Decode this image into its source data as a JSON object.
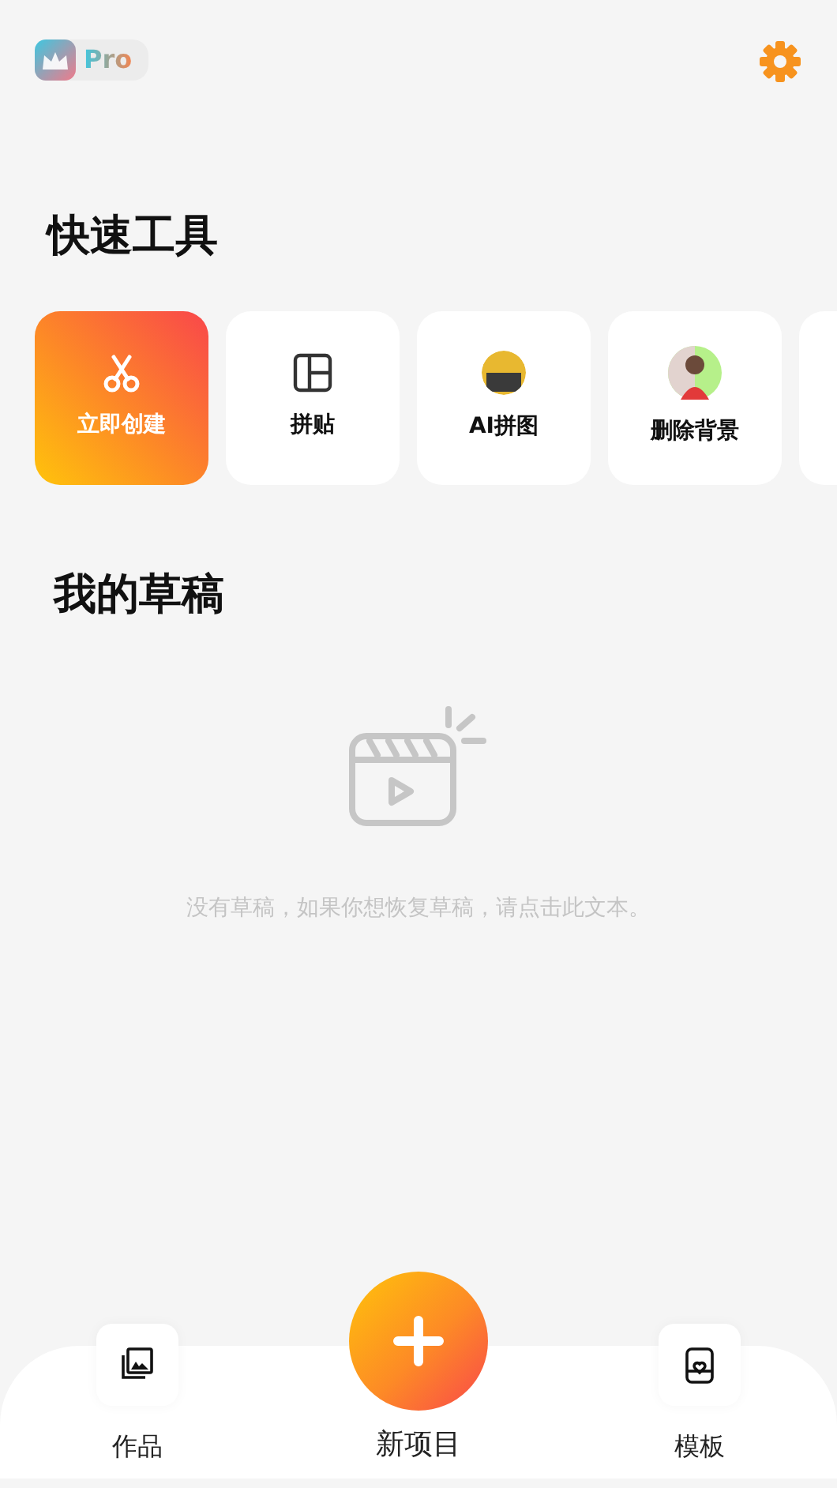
{
  "header": {
    "badge": "Pro"
  },
  "quick_tools": {
    "title": "快速工具",
    "items": [
      {
        "kind": "create",
        "label": "立即创建"
      },
      {
        "kind": "collage",
        "label": "拼贴"
      },
      {
        "kind": "photo",
        "label": "AI拼图"
      },
      {
        "kind": "portrait",
        "label": "删除背景"
      },
      {
        "kind": "partial"
      }
    ]
  },
  "drafts": {
    "title": "我的草稿",
    "empty_message": "没有草稿，如果你想恢复草稿，请点击此文本。"
  },
  "bottom_nav": [
    {
      "kind": "works",
      "label": "作品"
    },
    {
      "kind": "new",
      "label": "新项目"
    },
    {
      "kind": "templates",
      "label": "模板"
    }
  ]
}
